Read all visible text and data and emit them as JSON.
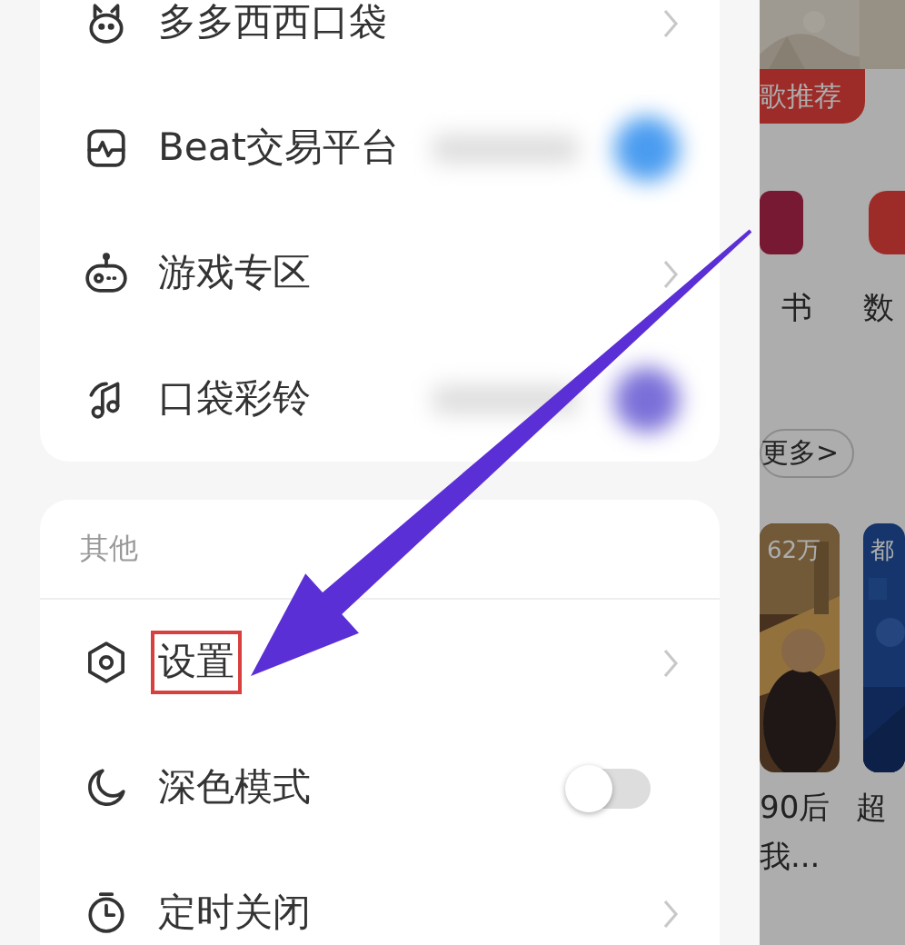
{
  "menu_groups": [
    {
      "items": [
        {
          "label": "多多西西口袋",
          "kind": "link"
        },
        {
          "label": "Beat交易平台",
          "kind": "blurred"
        },
        {
          "label": "游戏专区",
          "kind": "link"
        },
        {
          "label": "口袋彩铃",
          "kind": "blurred"
        }
      ]
    },
    {
      "header": "其他",
      "items": [
        {
          "label": "设置",
          "kind": "link",
          "highlighted": true
        },
        {
          "label": "深色模式",
          "kind": "toggle",
          "on": false
        },
        {
          "label": "定时关闭",
          "kind": "link",
          "highlighted": false
        }
      ]
    }
  ],
  "background_page": {
    "badge": "歌推荐",
    "shortcut_labels": [
      "书",
      "数"
    ],
    "more_button": "更多>",
    "cards": [
      {
        "count": "62万",
        "title": "90后",
        "subtitle": "我..."
      },
      {
        "count": "都",
        "title": "超"
      }
    ]
  }
}
